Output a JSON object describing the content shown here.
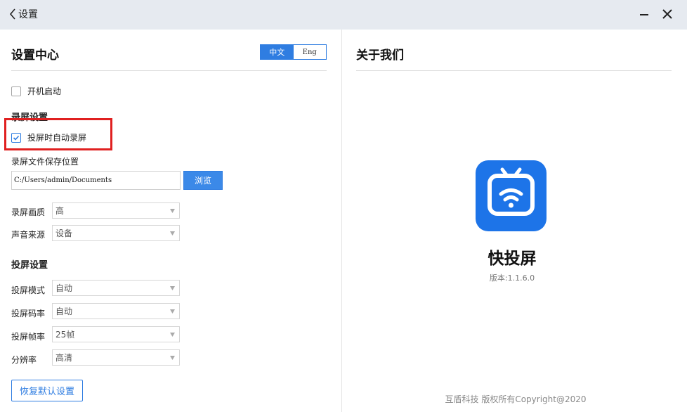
{
  "titlebar": {
    "title": "设置",
    "back_icon": "chevron-left-icon",
    "minimize_icon": "minimize-icon",
    "close_icon": "close-icon"
  },
  "settings": {
    "title": "设置中心",
    "lang": {
      "zh": "中文",
      "en": "Eng",
      "selected": "中文"
    },
    "startup": {
      "label": "开机启动",
      "checked": false
    },
    "record_section": "录屏设置",
    "auto_record": {
      "label": "投屏时自动录屏",
      "checked": true
    },
    "save_path_label": "录屏文件保存位置",
    "save_path_value": "C:/Users/admin/Documents",
    "browse_label": "浏览",
    "record_quality": {
      "label": "录屏画质",
      "value": "高"
    },
    "audio_source": {
      "label": "声音来源",
      "value": "设备"
    },
    "cast_section": "投屏设置",
    "cast_mode": {
      "label": "投屏模式",
      "value": "自动"
    },
    "cast_bitrate": {
      "label": "投屏码率",
      "value": "自动"
    },
    "cast_fps": {
      "label": "投屏帧率",
      "value": "25帧"
    },
    "resolution": {
      "label": "分辨率",
      "value": "高清"
    },
    "reset_label": "恢复默认设置"
  },
  "about": {
    "title": "关于我们",
    "app_icon": "tv-cast-logo-icon",
    "app_name": "快投屏",
    "version": "版本:1.1.6.0",
    "copyright": "互盾科技 版权所有Copyright@2020"
  },
  "colors": {
    "accent": "#2f7de1",
    "highlight": "#e02020",
    "titlebar_bg": "#e6eaf0"
  }
}
